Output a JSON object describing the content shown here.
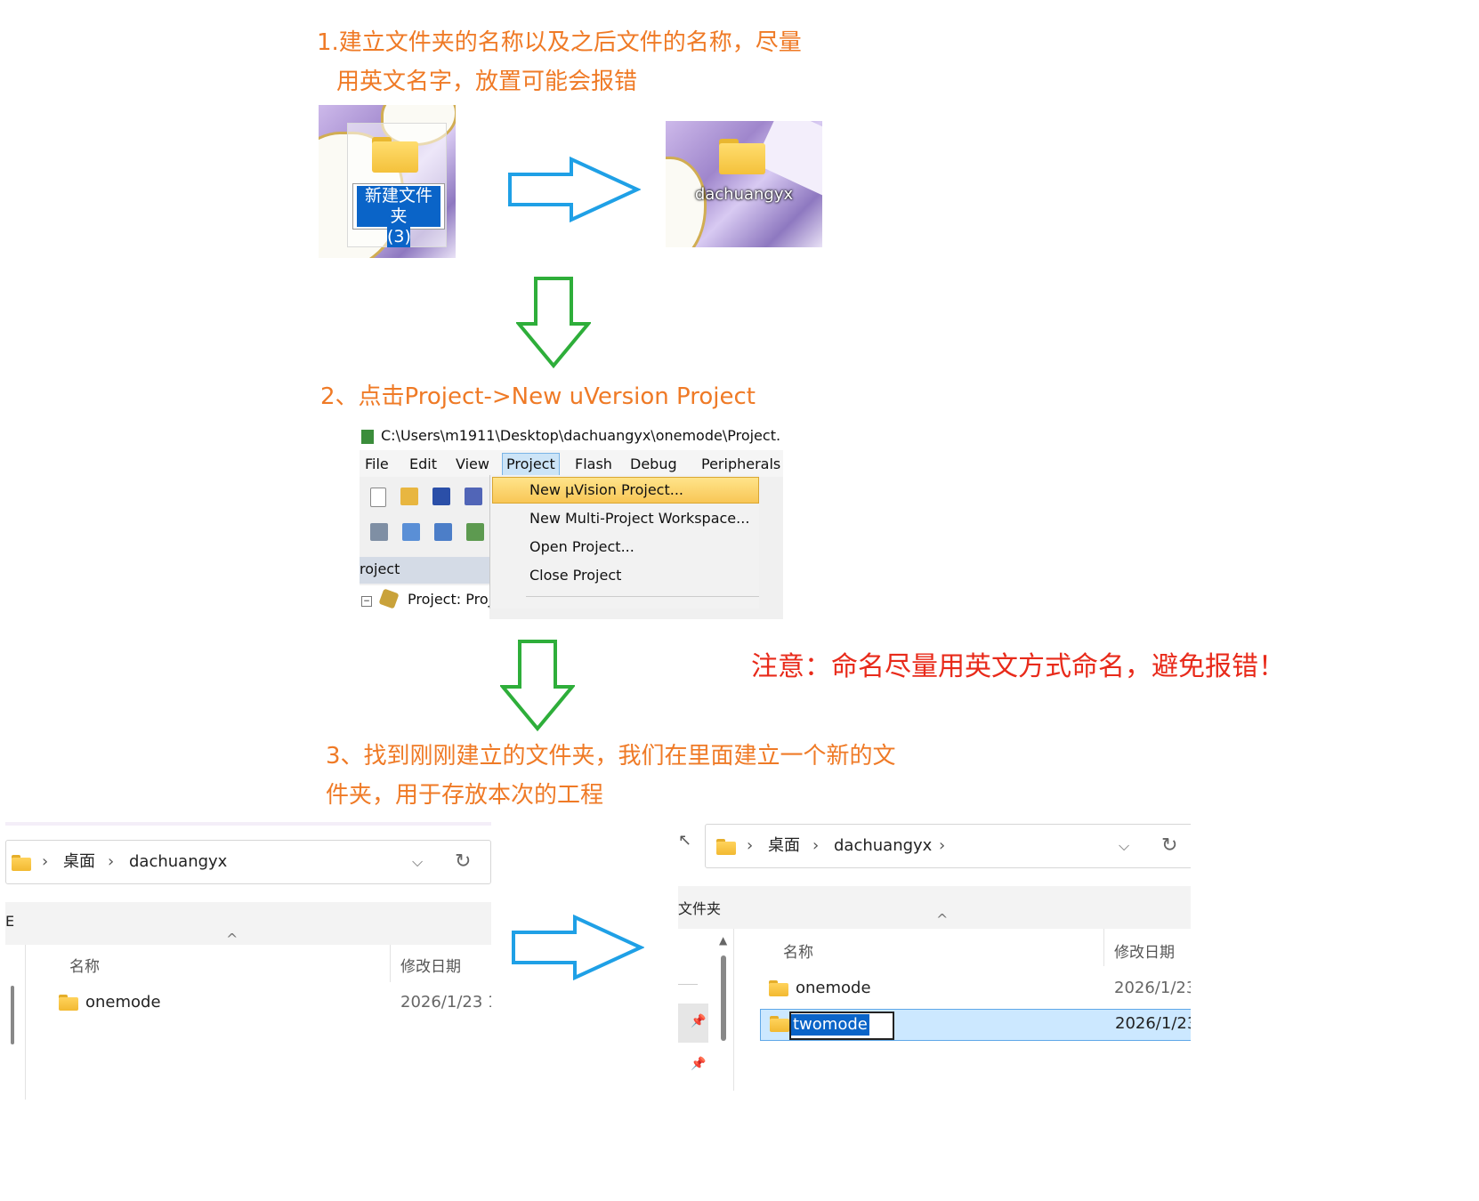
{
  "step1": {
    "line1": "1.建立文件夹的名称以及之后文件的名称，尽量",
    "line2": "用英文名字，放置可能会报错",
    "new_folder_label_line1": "新建文件夹",
    "new_folder_label_line2": "(3)",
    "renamed_folder_label": "dachuangyx"
  },
  "step2": {
    "text": "2、点击Project->New uVersion Project",
    "keil": {
      "title": "C:\\Users\\m1911\\Desktop\\dachuangyx\\onemode\\Project.",
      "menu": [
        "File",
        "Edit",
        "View",
        "Project",
        "Flash",
        "Debug",
        "Peripherals"
      ],
      "dropdown": [
        "New µVision Project...",
        "New Multi-Project Workspace...",
        "Open Project...",
        "Close Project"
      ],
      "panel_title": "roject",
      "tree_item": "Project: Proj"
    }
  },
  "note": "注意：命名尽量用英文方式命名，避免报错！",
  "step3": {
    "line1": "3、找到刚刚建立的文件夹，我们在里面建立一个新的文",
    "line2": "件夹，用于存放本次的工程"
  },
  "explorer_left": {
    "breadcrumb": [
      "桌面",
      "dachuangyx"
    ],
    "side_label": "E",
    "col_name": "名称",
    "col_date": "修改日期",
    "rows": [
      {
        "name": "onemode",
        "date": "2026/1/23 1"
      }
    ]
  },
  "explorer_right": {
    "breadcrumb": [
      "桌面",
      "dachuangyx"
    ],
    "side_label": "文件夹",
    "col_name": "名称",
    "col_date": "修改日期",
    "rows": [
      {
        "name": "onemode",
        "date": "2026/1/23"
      },
      {
        "name": "twomode",
        "date": "2026/1/23"
      }
    ]
  },
  "colors": {
    "step_text": "#ef7a26",
    "note_text": "#e82a1a",
    "arrow_blue": "#1fa0e6",
    "arrow_green": "#2eae3a",
    "selection": "#0a64c8"
  }
}
